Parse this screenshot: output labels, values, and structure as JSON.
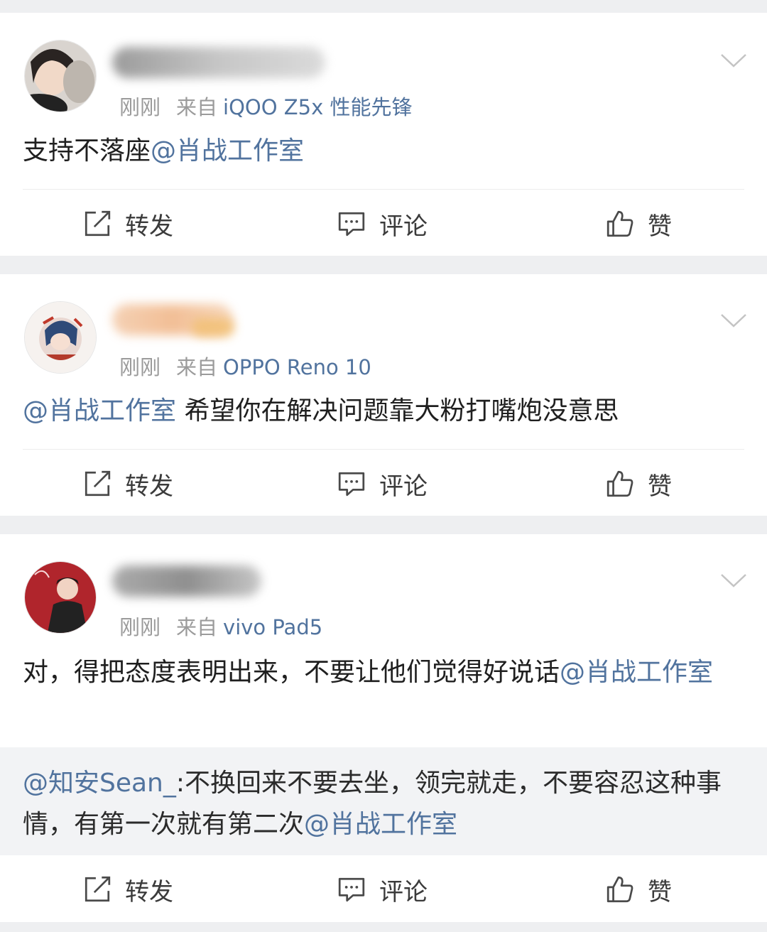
{
  "posts": [
    {
      "time": "刚刚",
      "from_label": "来自",
      "device": "iQOO Z5x 性能先锋",
      "content_text": "支持不落座",
      "content_mention": "@肖战工作室",
      "actions": {
        "repost": "转发",
        "comment": "评论",
        "like": "赞"
      }
    },
    {
      "time": "刚刚",
      "from_label": "来自",
      "device": "OPPO Reno 10",
      "content_mention": "@肖战工作室",
      "content_text": " 希望你在解决问题靠大粉打嘴炮没意思",
      "actions": {
        "repost": "转发",
        "comment": "评论",
        "like": "赞"
      }
    },
    {
      "time": "刚刚",
      "from_label": "来自",
      "device": "vivo Pad5",
      "content_text": "对，得把态度表明出来，不要让他们觉得好说话",
      "content_mention": "@肖战工作室",
      "quote": {
        "mention": "@知安Sean_",
        "text": ":不换回来不要去坐，领完就走，不要容忍这种事情，有第一次就有第二次",
        "tail_mention": "@肖战工作室"
      },
      "actions": {
        "repost": "转发",
        "comment": "评论",
        "like": "赞"
      }
    }
  ],
  "icons": {
    "repost": "repost-icon",
    "comment": "comment-icon",
    "like": "thumbs-up-icon",
    "menu": "chevron-down-icon"
  },
  "colors": {
    "mention": "#51739e",
    "meta": "#9b9b9b",
    "background": "#eeeff1"
  }
}
